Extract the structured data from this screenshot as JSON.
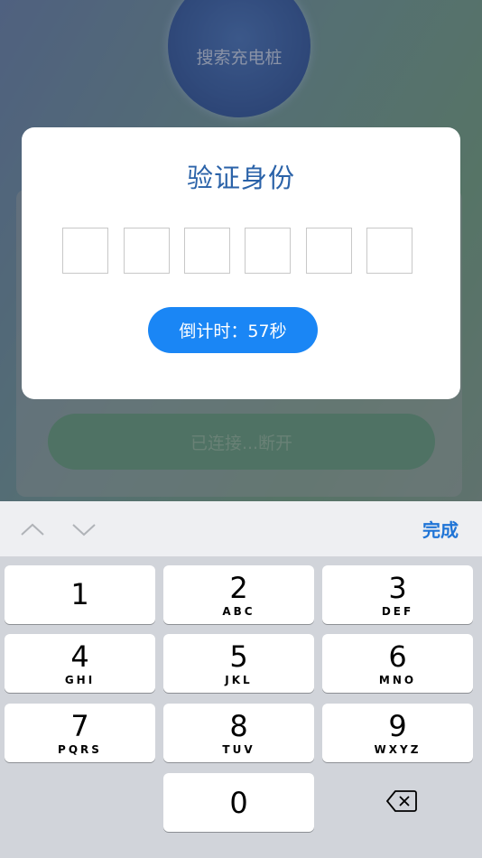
{
  "background": {
    "search_label": "搜索充电桩",
    "connect_label": "已连接...断开"
  },
  "dialog": {
    "title": "验证身份",
    "code_boxes": [
      "",
      "",
      "",
      "",
      "",
      ""
    ],
    "countdown_label": "倒计时：57秒"
  },
  "toolbar": {
    "prev_icon": "chevron-up-icon",
    "next_icon": "chevron-down-icon",
    "done_label": "完成"
  },
  "keypad": {
    "keys": [
      {
        "digit": "1",
        "letters": ""
      },
      {
        "digit": "2",
        "letters": "ABC"
      },
      {
        "digit": "3",
        "letters": "DEF"
      },
      {
        "digit": "4",
        "letters": "GHI"
      },
      {
        "digit": "5",
        "letters": "JKL"
      },
      {
        "digit": "6",
        "letters": "MNO"
      },
      {
        "digit": "7",
        "letters": "PQRS"
      },
      {
        "digit": "8",
        "letters": "TUV"
      },
      {
        "digit": "9",
        "letters": "WXYZ"
      },
      {
        "digit": "0",
        "letters": ""
      }
    ],
    "backspace_icon": "backspace-icon"
  },
  "colors": {
    "accent": "#1a86f5",
    "title": "#2a62a8",
    "done": "#1f74d6"
  }
}
